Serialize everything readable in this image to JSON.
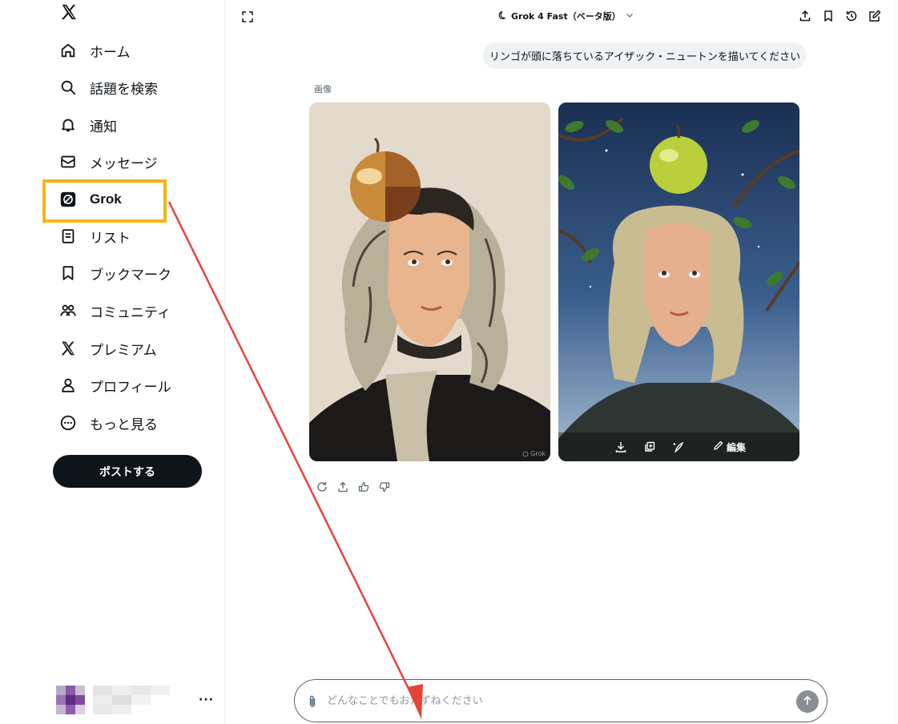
{
  "sidebar": {
    "items": [
      {
        "label": "ホーム",
        "icon": "home-icon"
      },
      {
        "label": "話題を検索",
        "icon": "search-icon"
      },
      {
        "label": "通知",
        "icon": "bell-icon"
      },
      {
        "label": "メッセージ",
        "icon": "envelope-icon"
      },
      {
        "label": "Grok",
        "icon": "grok-icon"
      },
      {
        "label": "リスト",
        "icon": "list-icon"
      },
      {
        "label": "ブックマーク",
        "icon": "bookmark-icon"
      },
      {
        "label": "コミュニティ",
        "icon": "community-icon"
      },
      {
        "label": "プレミアム",
        "icon": "x-logo-icon"
      },
      {
        "label": "プロフィール",
        "icon": "person-icon"
      },
      {
        "label": "もっと見る",
        "icon": "more-circle-icon"
      }
    ],
    "post_label": "ポストする",
    "more_label": "···"
  },
  "header": {
    "model_label": "Grok 4 Fast（ベータ版）"
  },
  "chat": {
    "user_message": "リンゴが頭に落ちているアイザック・ニュートンを描いてください",
    "images_label": "画像",
    "edit_label": "編集",
    "watermark": "Grok"
  },
  "composer": {
    "placeholder": "どんなことでもおたずねください"
  },
  "colors": {
    "highlight": "#f9b312",
    "arrow": "#e8433a",
    "text": "#0f1419",
    "muted": "#536471"
  }
}
